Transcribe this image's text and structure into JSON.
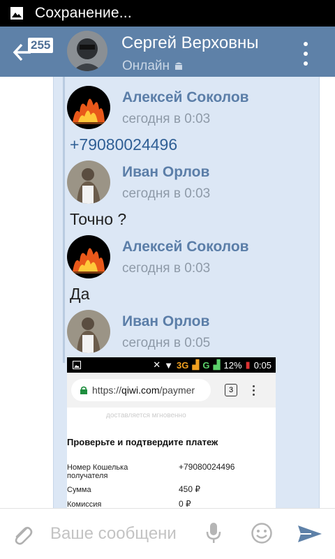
{
  "status_bar": {
    "icon": "image-icon",
    "text": "Сохранение..."
  },
  "header": {
    "unread_count": "255",
    "name": "Сергей Верховны",
    "status": "Онлайн",
    "status_icon": "android-icon"
  },
  "messages": [
    {
      "sender": "Алексей Соколов",
      "time": "сегодня в 0:03",
      "text": "+79080024496",
      "avatar": "fire-avatar"
    },
    {
      "sender": "Иван Орлов",
      "time": "сегодня в 0:03",
      "text": "Точно ?",
      "avatar": "person-avatar"
    },
    {
      "sender": "Алексей Соколов",
      "time": "сегодня в 0:03",
      "text": "Да",
      "avatar": "fire-avatar"
    },
    {
      "sender": "Иван Орлов",
      "time": "сегодня в 0:05",
      "text": "",
      "avatar": "person-avatar"
    }
  ],
  "attachment": {
    "status": {
      "net3g": "3G",
      "netg": "G",
      "battery": "12%",
      "time": "0:05"
    },
    "url_prefix": "https://",
    "url_domain": "qiwi.com",
    "url_rest": "/paymer",
    "tab_count": "3",
    "faint_text": "доставляется мгновенно",
    "title": "Проверьте и подтвердите платеж",
    "rows": [
      {
        "label": "Номер Кошелька получателя",
        "value": "+79080024496"
      },
      {
        "label": "Сумма",
        "value": "450 ₽"
      },
      {
        "label": "Комиссия",
        "value": "0 ₽"
      }
    ]
  },
  "input": {
    "placeholder": "Ваше сообщени"
  },
  "colors": {
    "header": "#5e81a8",
    "bubble": "#dce7f5",
    "name": "#5b7ea8",
    "link": "#2f5f95"
  }
}
